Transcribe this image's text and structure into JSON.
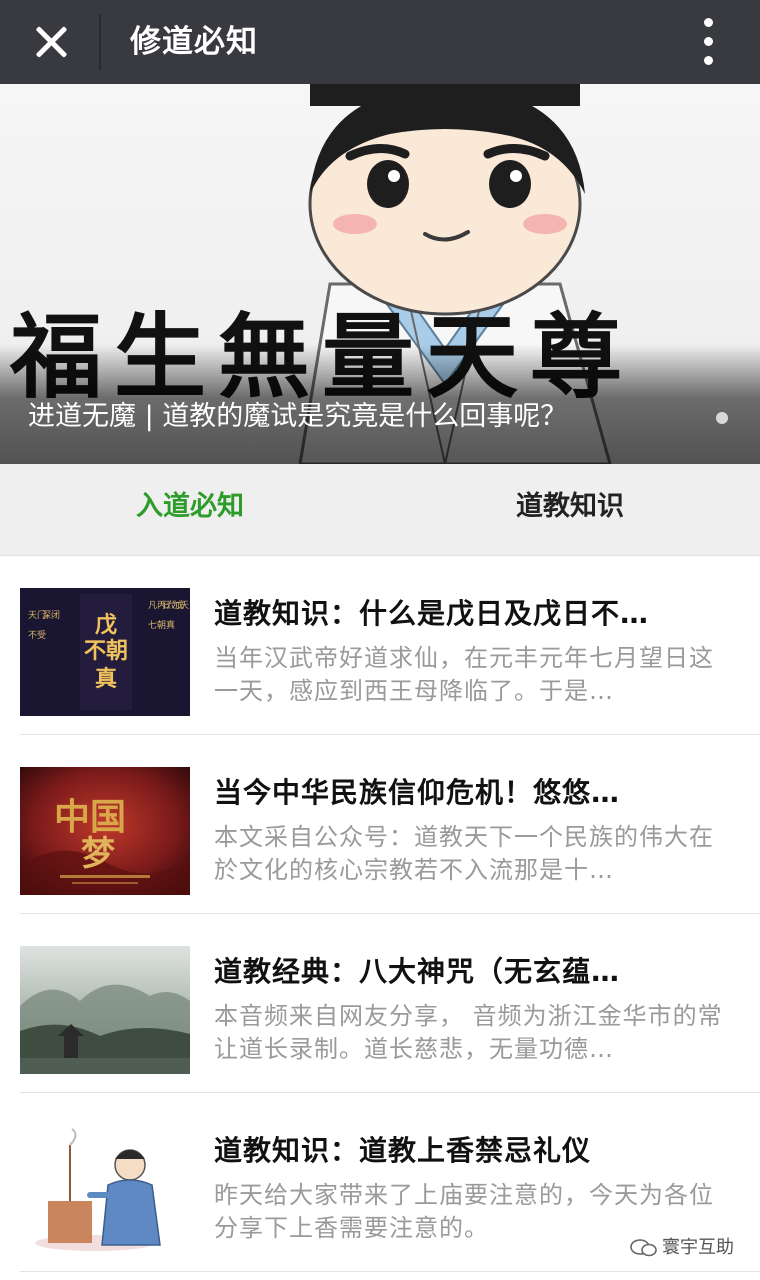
{
  "header": {
    "title": "修道必知"
  },
  "banner": {
    "caption": "进道无魔 | 道教的魔试是究竟是什么回事呢？",
    "calligraphy": "福生無量天尊"
  },
  "tabs": [
    {
      "label": "入道必知",
      "active": true
    },
    {
      "label": "道教知识",
      "active": false
    }
  ],
  "articles": [
    {
      "title": "道教知识：什么是戊日及戊日不…",
      "desc": "当年汉武帝好道求仙，在元丰元年七月望日这一天，感应到西王母降临了。于是…",
      "thumb_text": "戊不朝真"
    },
    {
      "title": "当今中华民族信仰危机！悠悠…",
      "desc": "本文采自公众号：道教天下一个民族的伟大在於文化的核心宗教若不入流那是十…",
      "thumb_text": "中国梦"
    },
    {
      "title": "道教经典：八大神咒（无玄蕴…",
      "desc": "本音频来自网友分享， 音频为浙江金华市的常让道长录制。道长慈悲，无量功德…",
      "thumb_text": ""
    },
    {
      "title": "道教知识：道教上香禁忌礼仪",
      "desc": "昨天给大家带来了上庙要注意的，今天为各位分享下上香需要注意的。",
      "thumb_text": ""
    }
  ],
  "watermark": {
    "text": "寰宇互助"
  },
  "colors": {
    "topbar": "#393a3f",
    "tab_active": "#2d9c2b",
    "tab_bg": "#efefef",
    "desc": "#9a9a9a"
  }
}
